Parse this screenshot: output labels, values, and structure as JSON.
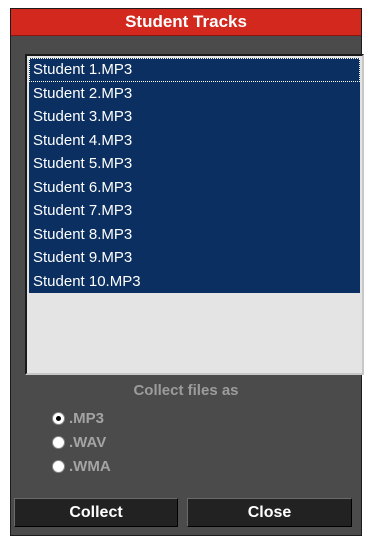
{
  "dialog": {
    "title": "Student Tracks"
  },
  "tracks": [
    "Student 1.MP3",
    "Student 2.MP3",
    "Student 3.MP3",
    "Student 4.MP3",
    "Student 5.MP3",
    "Student 6.MP3",
    "Student 7.MP3",
    "Student 8.MP3",
    "Student 9.MP3",
    "Student 10.MP3"
  ],
  "collect": {
    "label": "Collect files as",
    "options": [
      {
        "label": ".MP3",
        "selected": true
      },
      {
        "label": ".WAV",
        "selected": false
      },
      {
        "label": ".WMA",
        "selected": false
      }
    ]
  },
  "buttons": {
    "collect": "Collect",
    "close": "Close"
  }
}
